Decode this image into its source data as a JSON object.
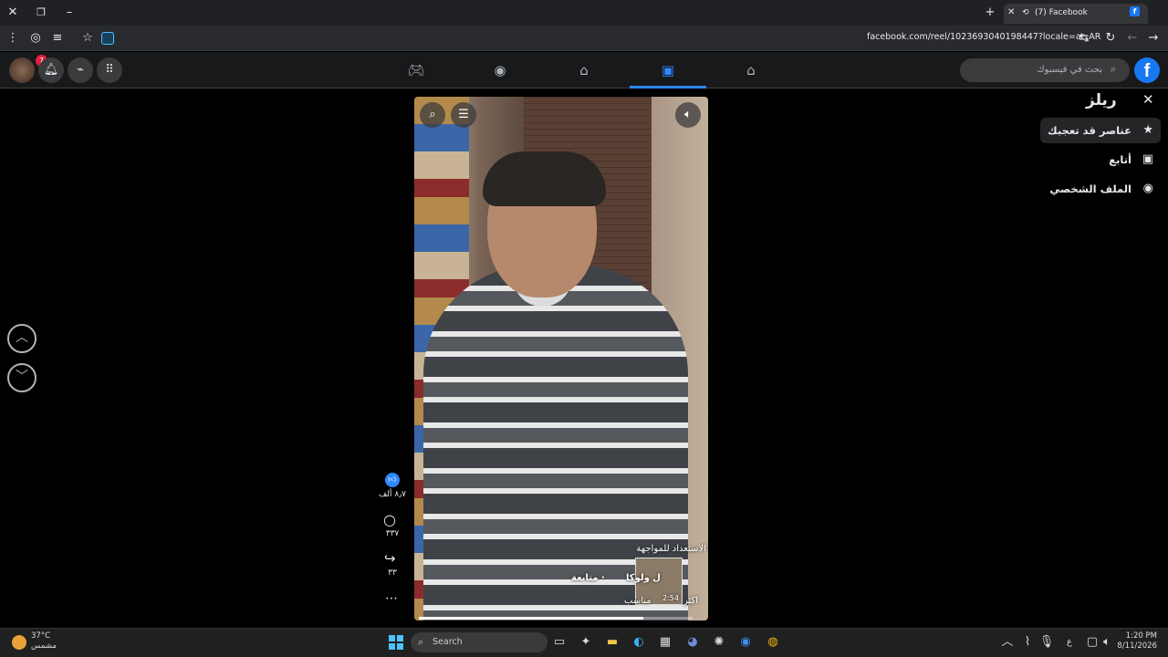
{
  "browser": {
    "tab_title": "(7) Facebook",
    "url": "facebook.com/reel/1023693040198447?locale=ar_AR",
    "new_tab": "+"
  },
  "fb": {
    "notif_count": "7",
    "search_placeholder": "بحث في فيسبوك",
    "logo_letter": "f"
  },
  "reels_panel": {
    "title": "ريلز",
    "items": [
      {
        "label": "عناصر قد تعجبك",
        "icon": "star-icon",
        "selected": true
      },
      {
        "label": "أتابع",
        "icon": "following-icon",
        "selected": false
      },
      {
        "label": "الملف الشخصي",
        "icon": "profile-icon",
        "selected": false
      }
    ]
  },
  "reel": {
    "likes": "٨٫٧ ألف",
    "comments": "٣٣٧",
    "shares": "٣٣",
    "caption": "الاستعداد للمواجهة",
    "author": "ل ولوكا",
    "follow": "· متابعة",
    "suggest_time": "2:54",
    "suggest_label": "مناسب",
    "more_label": "اكثر",
    "progress_fraction": 0.82
  },
  "taskbar": {
    "temp": "37°C",
    "weather": "مشمس",
    "search": "Search",
    "time": "1:20 PM",
    "date": "8/11/2026",
    "lang": "ع"
  }
}
